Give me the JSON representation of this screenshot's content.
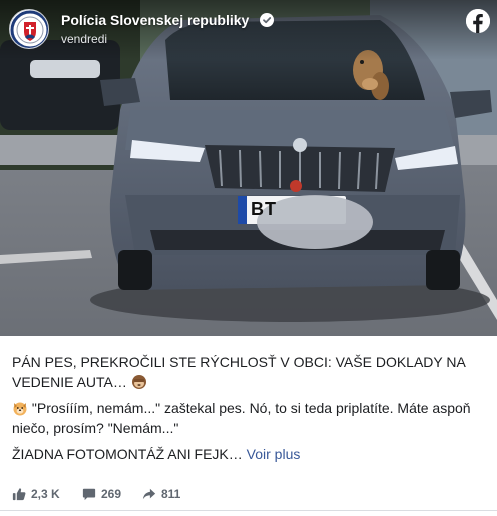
{
  "post": {
    "page_name": "Polícia Slovenskej republiky",
    "time": "vendredi",
    "text_1": "PÁN PES, PREKROČILI STE RÝCHLOSŤ V OBCI: VAŠE DOKLADY NA VEDENIE AUTA…",
    "text_2": "\"Prosííím, nemám...\" zaštekal pes. Nó, to si teda priplatíte. Máte aspoň niečo, prosím? \"Nemám...\"",
    "text_3": "ŽIADNA FOTOMONTÁŽ ANI FEJK…",
    "see_more": "Voir plus",
    "photo": {
      "plate_text": "BT"
    }
  },
  "stats": {
    "likes": "2,3 K",
    "comments": "269",
    "shares": "811"
  },
  "colors": {
    "text": "#1c1e21",
    "muted": "#606770",
    "link": "#385898",
    "car_body": "#5b6574"
  },
  "icons": [
    "police-crest-icon",
    "verified-badge-icon",
    "facebook-logo-icon",
    "monkey-emoji-icon",
    "dog-emoji-icon",
    "like-icon",
    "comment-icon",
    "share-icon"
  ]
}
